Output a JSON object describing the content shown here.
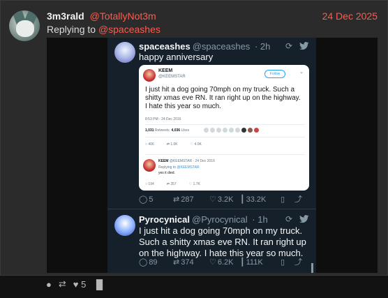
{
  "post": {
    "username": "3m3rald",
    "handle": "@TotallyNot3m",
    "date": "24 Dec 2025",
    "replying_prefix": "Replying to",
    "replying_to": "@spaceashes",
    "like_count": "5"
  },
  "tweet1": {
    "name": "spaceashes",
    "handle": "@spaceashes",
    "age": "· 2h",
    "text": "happy anniversary",
    "replies": "5",
    "retweets": "287",
    "likes": "3.2K",
    "views": "33.2K"
  },
  "card": {
    "name": "KEEM",
    "handle": "@KEEMSTAR",
    "follow": "Follow",
    "text": "I just hit a dog going 70mph on my truck. Such a shitty xmas eve RN. It ran right up on the highway. I hate this year so much.",
    "time": "8:53 PM - 24 Dec 2016",
    "retweets_num": "1,031",
    "retweets_label": "Retweets",
    "likes_num": "4,036",
    "likes_label": "Likes",
    "stat_replies": "406",
    "stat_retweets": "1.0K",
    "stat_likes": "4.0K",
    "reply_name": "KEEM",
    "reply_meta": "@KEEMSTAR · 24 Dec 2016",
    "reply_prefix": "Replying to",
    "reply_to": "@KEEMSTAR",
    "reply_text": "yes it died.",
    "reply_replies": "194",
    "reply_retweets": "357",
    "reply_likes": "1.7K"
  },
  "tweet2": {
    "name": "Pyrocynical",
    "handle": "@Pyrocynical",
    "age": "· 1h",
    "text": "I just hit a dog going 70mph on my truck. Such a shitty xmas eve RN. It ran right up on the highway. I hate this year so much.",
    "replies": "89",
    "retweets": "374",
    "likes": "6.2K",
    "views": "111K"
  },
  "colors": {
    "accent": "#ff5a4e",
    "twitter_bg": "#15202b",
    "twitter_blue": "#1da1f2"
  }
}
